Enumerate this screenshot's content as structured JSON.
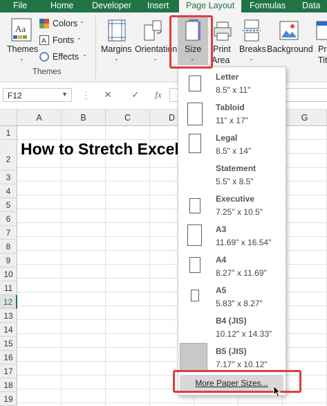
{
  "tabs": [
    "File",
    "Home",
    "Developer",
    "Insert",
    "Page Layout",
    "Formulas",
    "Data"
  ],
  "active_tab": "Page Layout",
  "ribbon": {
    "themes_label": "Themes",
    "colors_label": "Colors",
    "fonts_label": "Fonts",
    "effects_label": "Effects",
    "themes_group_label": "Themes",
    "margins_label": "Margins",
    "orientation_label": "Orientation",
    "size_label": "Size",
    "print_area_label_1": "Print",
    "print_area_label_2": "Area",
    "breaks_label": "Breaks",
    "background_label": "Background",
    "print_titles_label_1": "Pr",
    "print_titles_label_2": "Titl"
  },
  "formula_bar": {
    "name_box": "F12",
    "fx": "fx",
    "cancel": "✕",
    "enter": "✓"
  },
  "columns": [
    "A",
    "B",
    "C",
    "D",
    "E",
    "F",
    "G"
  ],
  "rows": [
    "1",
    "2",
    "3",
    "4",
    "5",
    "6",
    "7",
    "8",
    "9",
    "10",
    "11",
    "12",
    "13",
    "14",
    "15",
    "16",
    "17",
    "18",
    "19"
  ],
  "selected_row": "12",
  "cell_title": "How to Stretch Excel Spreadsheet",
  "paper_sizes": [
    {
      "name": "Letter",
      "dims": "8.5\" x 11\""
    },
    {
      "name": "Tabloid",
      "dims": "11\" x 17\""
    },
    {
      "name": "Legal",
      "dims": "8.5\" x 14\""
    },
    {
      "name": "Statement",
      "dims": "5.5\" x 8.5\""
    },
    {
      "name": "Executive",
      "dims": "7.25\" x 10.5\""
    },
    {
      "name": "A3",
      "dims": "11.69\" x 16.54\""
    },
    {
      "name": "A4",
      "dims": "8.27\" x 11.69\""
    },
    {
      "name": "A5",
      "dims": "5.83\" x 8.27\""
    },
    {
      "name": "B4 (JIS)",
      "dims": "10.12\" x 14.33\""
    },
    {
      "name": "B5 (JIS)",
      "dims": "7.17\" x 10.12\""
    }
  ],
  "more_paper_sizes": "More Paper Sizes...",
  "colors": {
    "accent": "#217346",
    "highlight": "#e03c3c"
  }
}
